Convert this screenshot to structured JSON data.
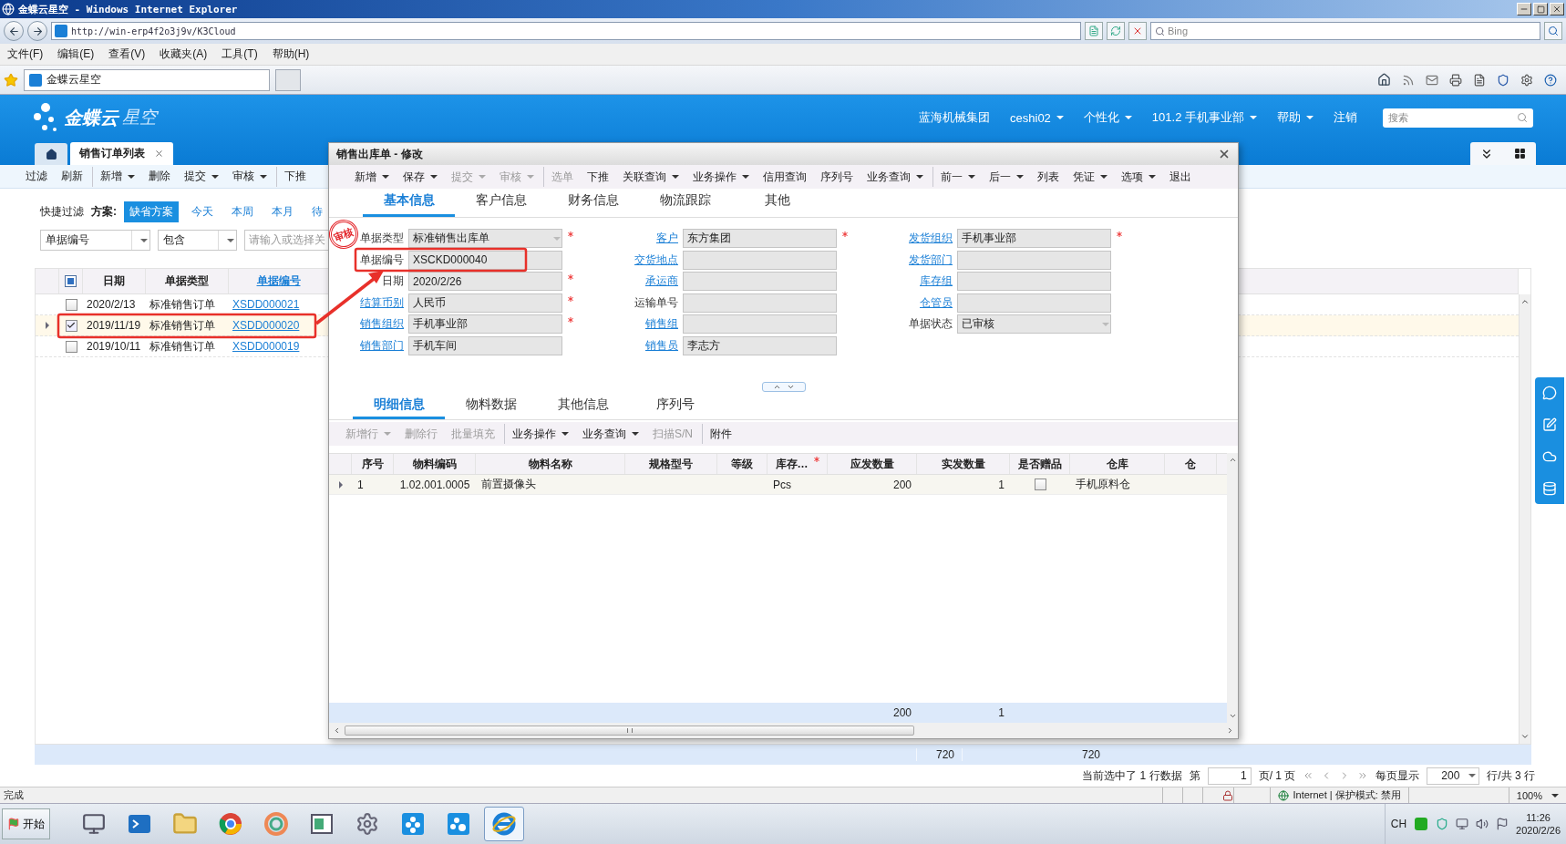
{
  "browser": {
    "title": "金蝶云星空 - Windows Internet Explorer",
    "url": "http://win-erp4f2o3j9v/K3Cloud",
    "search_placeholder": "Bing",
    "menu": [
      "文件(F)",
      "编辑(E)",
      "查看(V)",
      "收藏夹(A)",
      "工具(T)",
      "帮助(H)"
    ],
    "tab": "金蝶云星空",
    "status": "完成",
    "zone": "Internet | 保护模式: 禁用",
    "zoom": "100%"
  },
  "header": {
    "logo": "金蝶云",
    "logo_sub": "星空",
    "search_placeholder": "搜索",
    "nav": [
      {
        "label": "蓝海机械集团",
        "dropdown": false
      },
      {
        "label": "ceshi02",
        "dropdown": true
      },
      {
        "label": "个性化",
        "dropdown": true
      },
      {
        "label": "101.2  手机事业部",
        "dropdown": true
      },
      {
        "label": "帮助",
        "dropdown": true
      },
      {
        "label": "注销",
        "dropdown": false
      }
    ],
    "tabs": [
      {
        "label": "销售订单列表",
        "selected": true
      }
    ]
  },
  "list": {
    "toolbar": [
      {
        "label": "过滤",
        "dropdown": false,
        "divider": false
      },
      {
        "label": "刷新",
        "dropdown": false,
        "divider": false
      },
      {
        "label": "新增",
        "dropdown": true,
        "divider": true
      },
      {
        "label": "删除",
        "dropdown": false,
        "divider": false
      },
      {
        "label": "提交",
        "dropdown": true,
        "divider": false
      },
      {
        "label": "审核",
        "dropdown": true,
        "divider": false
      },
      {
        "label": "下推",
        "dropdown": false,
        "divider": true
      }
    ],
    "filter": {
      "label": "快捷过滤",
      "scheme_label": "方案:",
      "field": "单据编号",
      "operator": "包含",
      "value_placeholder": "请输入或选择关",
      "schemes": [
        {
          "label": "缺省方案",
          "selected": true
        },
        {
          "label": "今天",
          "selected": false
        },
        {
          "label": "本周",
          "selected": false
        },
        {
          "label": "本月",
          "selected": false
        },
        {
          "label": "待",
          "selected": false
        }
      ]
    },
    "select_all_partial": true,
    "columns": [
      {
        "label": "日期",
        "link": false
      },
      {
        "label": "单据类型",
        "link": false
      },
      {
        "label": "单据编号",
        "link": true
      }
    ],
    "rows": [
      {
        "date": "2020/2/13",
        "type": "标准销售订单",
        "number": "XSDD000021",
        "checked": false,
        "selected": false
      },
      {
        "date": "2019/11/19",
        "type": "标准销售订单",
        "number": "XSDD000020",
        "checked": true,
        "selected": true
      },
      {
        "date": "2019/10/11",
        "type": "标准销售订单",
        "number": "XSDD000019",
        "checked": false,
        "selected": false
      }
    ],
    "totals": [
      "720",
      "720"
    ],
    "pager": {
      "summary": "当前选中了 1 行数据",
      "page_label": "第",
      "page": "1",
      "page_of": "页/ 1 页",
      "page_size_label": "每页显示",
      "page_size": "200",
      "total": "行/共  3 行"
    }
  },
  "dialog": {
    "title": "销售出库单 - 修改",
    "stamp": "审核",
    "toolbar": [
      {
        "label": "新增",
        "dropdown": true,
        "disabled": false,
        "divider": false
      },
      {
        "label": "保存",
        "dropdown": true,
        "disabled": false,
        "divider": false
      },
      {
        "label": "提交",
        "dropdown": true,
        "disabled": true,
        "divider": false
      },
      {
        "label": "审核",
        "dropdown": true,
        "disabled": true,
        "divider": false
      },
      {
        "label": "选单",
        "dropdown": false,
        "disabled": true,
        "divider": true
      },
      {
        "label": "下推",
        "dropdown": false,
        "disabled": false,
        "divider": false
      },
      {
        "label": "关联查询",
        "dropdown": true,
        "disabled": false,
        "divider": false
      },
      {
        "label": "业务操作",
        "dropdown": true,
        "disabled": false,
        "divider": false
      },
      {
        "label": "信用查询",
        "dropdown": false,
        "disabled": false,
        "divider": false
      },
      {
        "label": "序列号",
        "dropdown": false,
        "disabled": false,
        "divider": false
      },
      {
        "label": "业务查询",
        "dropdown": true,
        "disabled": false,
        "divider": false
      },
      {
        "label": "前一",
        "dropdown": true,
        "disabled": false,
        "divider": true
      },
      {
        "label": "后一",
        "dropdown": true,
        "disabled": false,
        "divider": false
      },
      {
        "label": "列表",
        "dropdown": false,
        "disabled": false,
        "divider": false
      },
      {
        "label": "凭证",
        "dropdown": true,
        "disabled": false,
        "divider": false
      },
      {
        "label": "选项",
        "dropdown": true,
        "disabled": false,
        "divider": false
      },
      {
        "label": "退出",
        "dropdown": false,
        "disabled": false,
        "divider": false
      }
    ],
    "tabs": [
      {
        "label": "基本信息",
        "selected": true
      },
      {
        "label": "客户信息",
        "selected": false
      },
      {
        "label": "财务信息",
        "selected": false
      },
      {
        "label": "物流跟踪",
        "selected": false
      },
      {
        "label": "其他",
        "selected": false
      }
    ],
    "field_columns": [
      {
        "fields": [
          {
            "label": "单据类型",
            "value": "标准销售出库单",
            "link": false,
            "required": true,
            "kind": "select"
          },
          {
            "label": "单据编号",
            "value": "XSCKD000040",
            "link": false,
            "required": false,
            "kind": "text"
          },
          {
            "label": "日期",
            "value": "2020/2/26",
            "link": false,
            "required": true,
            "kind": "text"
          },
          {
            "label": "结算币别",
            "value": "人民币",
            "link": true,
            "required": true,
            "kind": "text"
          },
          {
            "label": "销售组织",
            "value": "手机事业部",
            "link": true,
            "required": true,
            "kind": "text"
          },
          {
            "label": "销售部门",
            "value": "手机车间",
            "link": true,
            "required": false,
            "kind": "text"
          }
        ]
      },
      {
        "fields": [
          {
            "label": "客户",
            "value": "东方集团",
            "link": true,
            "required": true,
            "kind": "text"
          },
          {
            "label": "交货地点",
            "link": true,
            "required": false,
            "kind": "text"
          },
          {
            "label": "承运商",
            "link": true,
            "required": false,
            "kind": "text"
          },
          {
            "label": "运输单号",
            "link": false,
            "required": false,
            "kind": "text"
          },
          {
            "label": "销售组",
            "link": true,
            "required": false,
            "kind": "text"
          },
          {
            "label": "销售员",
            "value": "李志方",
            "link": true,
            "required": false,
            "kind": "text"
          }
        ]
      },
      {
        "fields": [
          {
            "label": "发货组织",
            "value": "手机事业部",
            "link": true,
            "required": true,
            "kind": "text"
          },
          {
            "label": "发货部门",
            "link": true,
            "required": false,
            "kind": "text"
          },
          {
            "label": "库存组",
            "link": true,
            "required": false,
            "kind": "text"
          },
          {
            "label": "仓管员",
            "link": true,
            "required": false,
            "kind": "text"
          },
          {
            "label": "单据状态",
            "value": "已审核",
            "link": false,
            "required": false,
            "kind": "select"
          }
        ]
      }
    ],
    "detail_tabs": [
      {
        "label": "明细信息",
        "selected": true
      },
      {
        "label": "物料数据",
        "selected": false
      },
      {
        "label": "其他信息",
        "selected": false
      },
      {
        "label": "序列号",
        "selected": false
      }
    ],
    "detail_toolbar": [
      {
        "label": "新增行",
        "dropdown": true,
        "disabled": true,
        "divider": false
      },
      {
        "label": "删除行",
        "dropdown": false,
        "disabled": true,
        "divider": false
      },
      {
        "label": "批量填充",
        "dropdown": false,
        "disabled": true,
        "divider": false
      },
      {
        "label": "业务操作",
        "dropdown": true,
        "disabled": false,
        "divider": true
      },
      {
        "label": "业务查询",
        "dropdown": true,
        "disabled": false,
        "divider": false
      },
      {
        "label": "扫描S/N",
        "dropdown": false,
        "disabled": true,
        "divider": false
      },
      {
        "label": "附件",
        "dropdown": false,
        "disabled": false,
        "divider": true
      }
    ],
    "detail_columns": [
      {
        "label": "序号",
        "required": false
      },
      {
        "label": "物料编码",
        "required": false
      },
      {
        "label": "物料名称",
        "required": false
      },
      {
        "label": "规格型号",
        "required": false
      },
      {
        "label": "等级",
        "required": false
      },
      {
        "label": "库存…",
        "required": true
      },
      {
        "label": "应发数量",
        "required": false
      },
      {
        "label": "实发数量",
        "required": false
      },
      {
        "label": "是否赠品",
        "required": false
      },
      {
        "label": "仓库",
        "required": false
      },
      {
        "label": "仓",
        "required": false
      }
    ],
    "detail_rows": [
      {
        "seq": "1",
        "code": "1.02.001.0005",
        "name": "前置摄像头",
        "unit": "Pcs",
        "due_qty": "200",
        "actual_qty": "1",
        "gift": false,
        "warehouse": "手机原料仓",
        "selected": true
      }
    ],
    "detail_totals": {
      "due_qty": "200",
      "actual_qty": "1"
    }
  },
  "taskbar": {
    "start": "开始",
    "lang": "CH",
    "time": "11:26",
    "date": "2020/2/26"
  }
}
